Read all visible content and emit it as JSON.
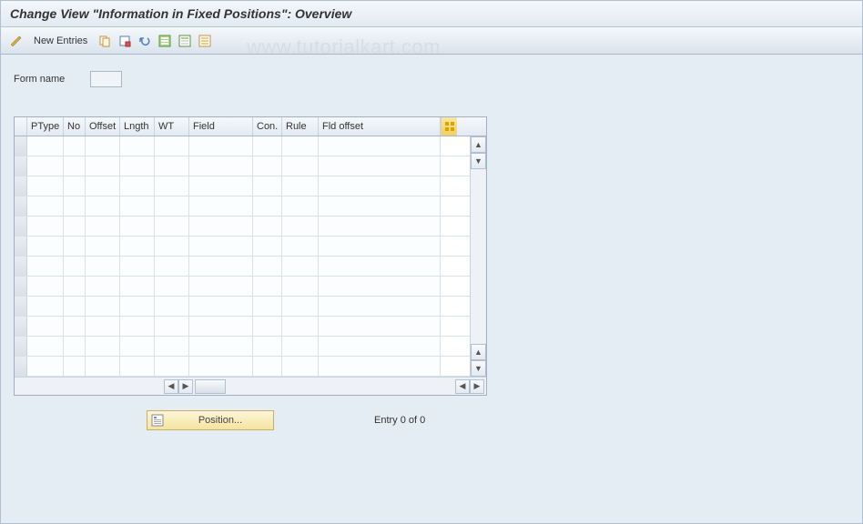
{
  "title": "Change View \"Information in Fixed Positions\": Overview",
  "watermark": "www.tutorialkart.com",
  "toolbar": {
    "new_entries_label": "New Entries"
  },
  "form": {
    "form_name_label": "Form name",
    "form_name_value": ""
  },
  "grid": {
    "columns": {
      "ptype": "PType",
      "no": "No",
      "offset": "Offset",
      "lngth": "Lngth",
      "wt": "WT",
      "field": "Field",
      "con": "Con.",
      "rule": "Rule",
      "fldoffset": "Fld offset"
    },
    "row_count": 12
  },
  "footer": {
    "position_label": "Position...",
    "entry_text": "Entry 0 of 0"
  }
}
